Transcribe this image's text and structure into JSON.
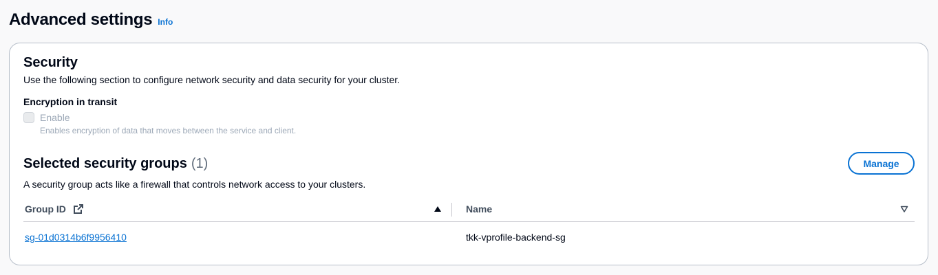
{
  "header": {
    "title": "Advanced settings",
    "info_label": "Info"
  },
  "security": {
    "title": "Security",
    "description": "Use the following section to configure network security and data security for your cluster.",
    "encryption": {
      "label": "Encryption in transit",
      "checkbox_label": "Enable",
      "checkbox_description": "Enables encryption of data that moves between the service and client.",
      "checked": false,
      "disabled": true
    }
  },
  "security_groups": {
    "title": "Selected security groups",
    "count": "(1)",
    "manage_label": "Manage",
    "description": "A security group acts like a firewall that controls network access to your clusters.",
    "columns": {
      "group_id": "Group ID",
      "name": "Name"
    },
    "sort": {
      "column": "group_id",
      "direction": "ascending"
    },
    "rows": [
      {
        "group_id": "sg-01d0314b6f9956410",
        "name": "tkk-vprofile-backend-sg"
      }
    ]
  },
  "icons": {
    "external_link": "external-link-icon",
    "sort_ascending": "caret-up-filled-icon",
    "sort_unsorted": "caret-down-outline-icon"
  },
  "colors": {
    "link": "#0972d3",
    "text": "#000716",
    "disabled_text": "#9ba7b6",
    "border": "#b6bec9",
    "page_background": "#f9f9fa"
  }
}
